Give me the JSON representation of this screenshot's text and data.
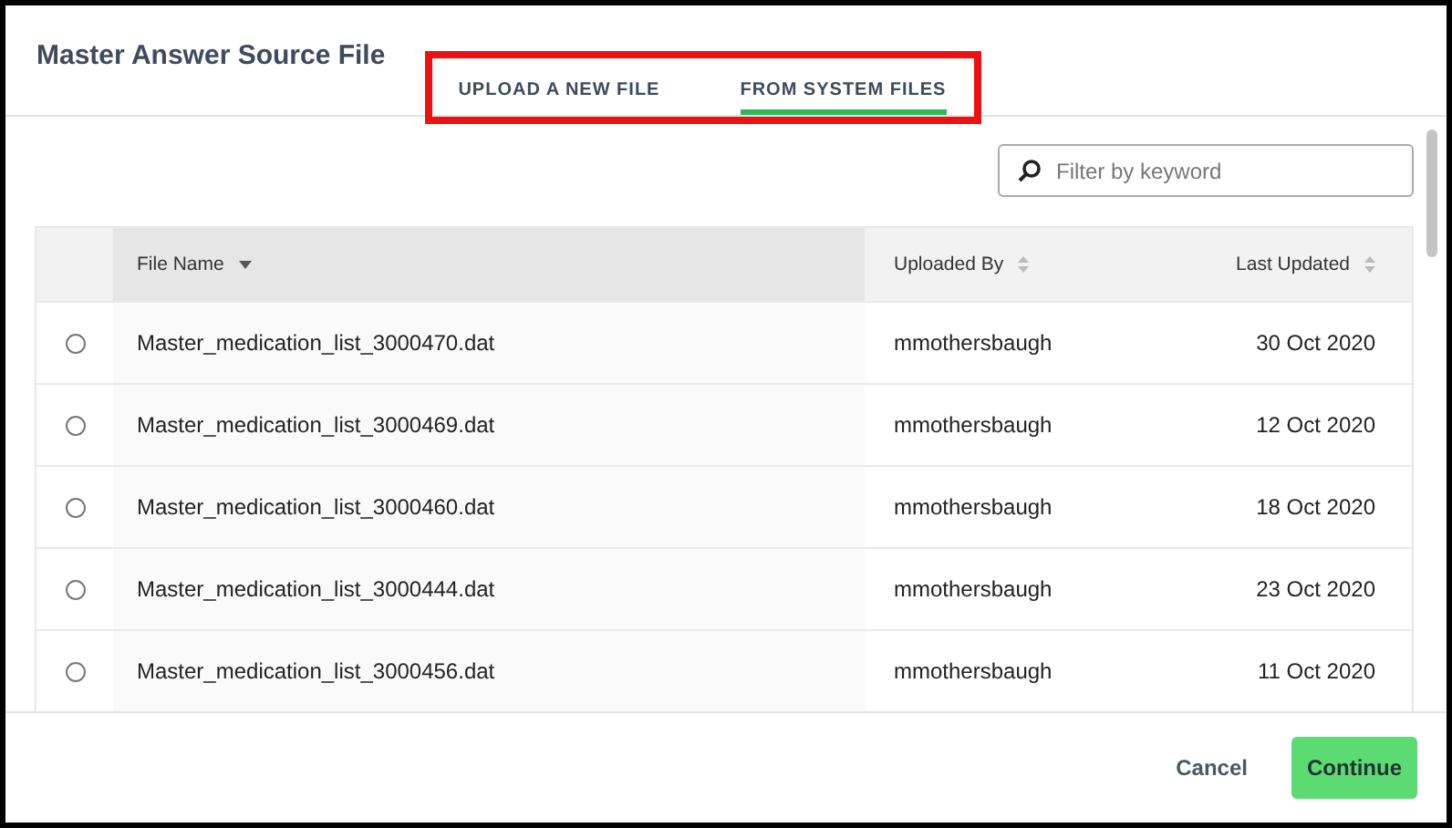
{
  "dialog": {
    "title": "Master Answer Source File"
  },
  "tabs": [
    {
      "label": "UPLOAD A NEW FILE",
      "selected": false
    },
    {
      "label": "FROM SYSTEM FILES",
      "selected": true
    }
  ],
  "highlight": {
    "color": "#ee1111"
  },
  "filter": {
    "placeholder": "Filter by keyword"
  },
  "table": {
    "columns": [
      {
        "label": "File Name",
        "sorted": true
      },
      {
        "label": "Uploaded By",
        "sorted": false
      },
      {
        "label": "Last Updated",
        "sorted": false
      }
    ],
    "rows": [
      {
        "selected": false,
        "file": "Master_medication_list_3000470.dat",
        "user": "mmothersbaugh",
        "date": "30 Oct 2020"
      },
      {
        "selected": false,
        "file": "Master_medication_list_3000469.dat",
        "user": "mmothersbaugh",
        "date": "12 Oct 2020"
      },
      {
        "selected": false,
        "file": "Master_medication_list_3000460.dat",
        "user": "mmothersbaugh",
        "date": "18 Oct 2020"
      },
      {
        "selected": false,
        "file": "Master_medication_list_3000444.dat",
        "user": "mmothersbaugh",
        "date": "23 Oct 2020"
      },
      {
        "selected": false,
        "file": "Master_medication_list_3000456.dat",
        "user": "mmothersbaugh",
        "date": "11 Oct 2020"
      }
    ]
  },
  "buttons": {
    "cancel": "Cancel",
    "continue": "Continue"
  }
}
